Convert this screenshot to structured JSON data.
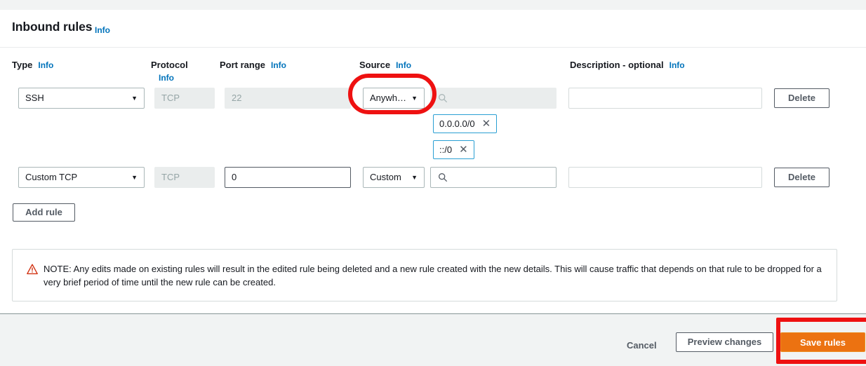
{
  "section": {
    "title": "Inbound rules",
    "info_label": "Info"
  },
  "columns": {
    "type": "Type",
    "type_info": "Info",
    "protocol": "Protocol",
    "protocol_info": "Info",
    "port_range": "Port range",
    "port_range_info": "Info",
    "source": "Source",
    "source_info": "Info",
    "description": "Description - optional",
    "description_info": "Info"
  },
  "rules": [
    {
      "type": "SSH",
      "protocol": "TCP",
      "port_range": "22",
      "source_type": "Anywh…",
      "source_search_value": "",
      "description": "",
      "delete_label": "Delete",
      "tags": [
        "0.0.0.0/0",
        "::/0"
      ]
    },
    {
      "type": "Custom TCP",
      "protocol": "TCP",
      "port_range": "0",
      "source_type": "Custom",
      "source_search_value": "",
      "description": "",
      "delete_label": "Delete",
      "tags": []
    }
  ],
  "add_rule_label": "Add rule",
  "alert": {
    "text": "NOTE: Any edits made on existing rules will result in the edited rule being deleted and a new rule created with the new details. This will cause traffic that depends on that rule to be dropped for a very brief period of time until the new rule can be created."
  },
  "footer": {
    "cancel_label": "Cancel",
    "preview_label": "Preview changes",
    "save_label": "Save rules"
  },
  "colors": {
    "primary_button": "#ec7211",
    "info_link": "#0073bb",
    "tag_border": "#2a9fd3",
    "annotation": "#ee1111",
    "warning_icon": "#d13212"
  }
}
